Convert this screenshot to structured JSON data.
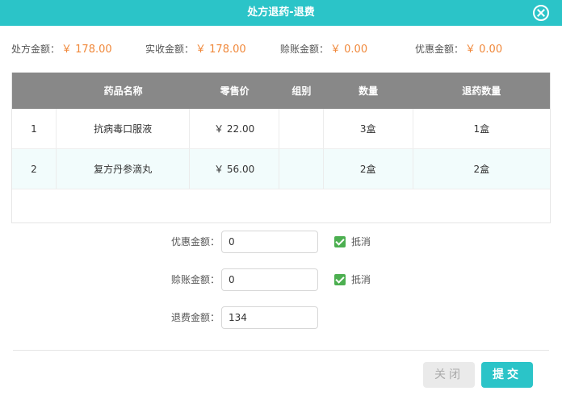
{
  "dialog": {
    "title": "处方退药-退费",
    "close_icon": "close-circle-icon"
  },
  "summary": {
    "prescription": {
      "label": "处方金额：",
      "amount": "￥ 178.00"
    },
    "received": {
      "label": "实收金额：",
      "amount": "￥ 178.00"
    },
    "credit": {
      "label": "赊账金额：",
      "amount": "￥ 0.00"
    },
    "discount": {
      "label": "优惠金额：",
      "amount": "￥ 0.00"
    }
  },
  "table": {
    "headers": [
      "",
      "药品名称",
      "零售价",
      "组别",
      "数量",
      "退药数量"
    ],
    "rows": [
      {
        "idx": "1",
        "name": "抗病毒口服液",
        "price": "￥ 22.00",
        "group": "",
        "qty": "3盒",
        "return_qty": "1盒"
      },
      {
        "idx": "2",
        "name": "复方丹参滴丸",
        "price": "￥ 56.00",
        "group": "",
        "qty": "2盒",
        "return_qty": "2盒"
      }
    ]
  },
  "form": {
    "discount": {
      "label": "优惠金额：",
      "value": "0",
      "checkbox_label": "抵消",
      "checked": true
    },
    "credit": {
      "label": "赊账金额：",
      "value": "0",
      "checkbox_label": "抵消",
      "checked": true
    },
    "refund": {
      "label": "退费金额：",
      "value": "134"
    }
  },
  "buttons": {
    "close": "关闭",
    "submit": "提交"
  },
  "colors": {
    "accent": "#2bc4c8",
    "amount": "#f0883a",
    "table_header": "#888888",
    "checkbox": "#4caf50"
  }
}
